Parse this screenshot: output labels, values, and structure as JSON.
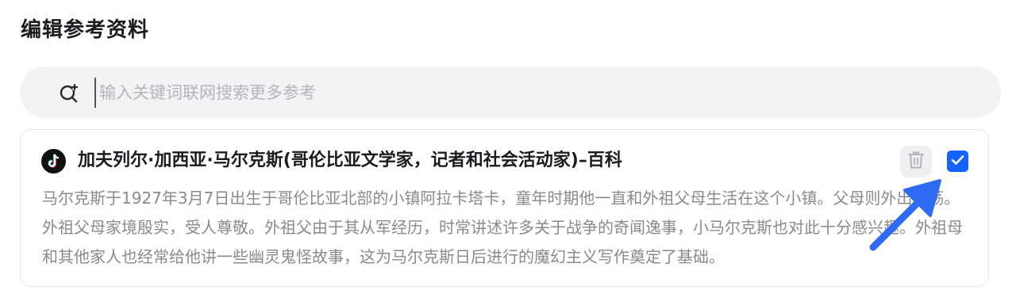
{
  "header": {
    "title": "编辑参考资料"
  },
  "search": {
    "placeholder": "输入关键词联网搜索更多参考",
    "value": "",
    "icon": "search-plus-icon"
  },
  "reference_card": {
    "source_icon": "tiktok-logo-icon",
    "title": "加夫列尔·加西亚·马尔克斯(哥伦比亚文学家，记者和社会活动家)–百科",
    "snippet": "马尔克斯于1927年3月7日出生于哥伦比亚北部的小镇阿拉卡塔卡，童年时期他一直和外祖父母生活在这个小镇。父母则外出闯荡。外祖父母家境殷实，受人尊敬。外祖父由于其从军经历，时常讲述许多关于战争的奇闻逸事，小马尔克斯也对此十分感兴趣。外祖母和其他家人也经常给他讲一些幽灵鬼怪故事，这为马尔克斯日后进行的魔幻主义写作奠定了基础。",
    "delete_icon": "trash-icon",
    "checked": true
  },
  "colors": {
    "accent": "#1463ff",
    "search_bg": "#f3f3f4",
    "snippet_text": "#8a8a8e",
    "annotation_arrow": "#2f6bf2"
  }
}
